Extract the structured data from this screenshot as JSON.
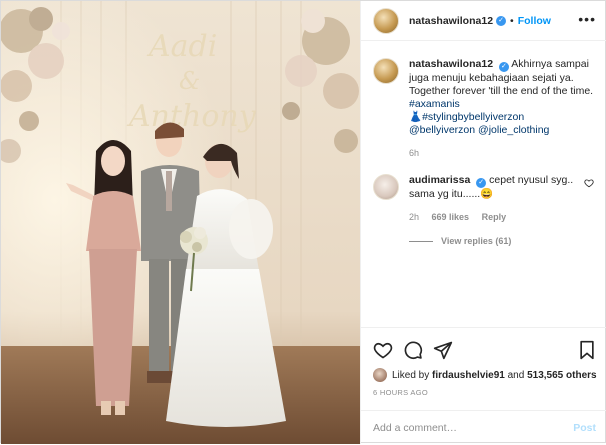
{
  "post": {
    "username": "natashawilona12",
    "follow_label": "Follow",
    "separator": "•"
  },
  "caption": {
    "username": "natashawilona12",
    "text": "Akhirnya sampai juga menuju kebahagiaan sejati ya. Together forever 'till the end of the time. ",
    "hashtag": "#axamanis",
    "dress_emoji": "👗",
    "tag_styling": "#stylingbybellyiverzon",
    "mention1": "@bellyiverzon",
    "mention2": "@jolie_clothing",
    "time": "6h"
  },
  "comment": {
    "username": "audimarissa",
    "text": "cepet nyusul syg.. sama yg itu......😄",
    "time": "2h",
    "likes": "669 likes",
    "reply": "Reply",
    "view_replies": "View replies (61)"
  },
  "backdrop_text": {
    "line1": "Aadi",
    "line2": "&",
    "line3": "Anthony"
  },
  "likes": {
    "prefix": "Liked by",
    "user": "firdaushelvie91",
    "middle": "and",
    "count": "513,565 others"
  },
  "timestamp": "6 HOURS AGO",
  "add_comment": {
    "placeholder": "Add a comment…",
    "post_label": "Post"
  },
  "colors": {
    "link": "#00376b",
    "follow": "#0095f6",
    "verified": "#3897f0",
    "muted": "#8e8e8e",
    "post_disabled": "#b2dffc"
  },
  "icons": [
    "heart-icon",
    "comment-icon",
    "share-icon",
    "save-icon",
    "more-options-icon",
    "verified-icon"
  ]
}
